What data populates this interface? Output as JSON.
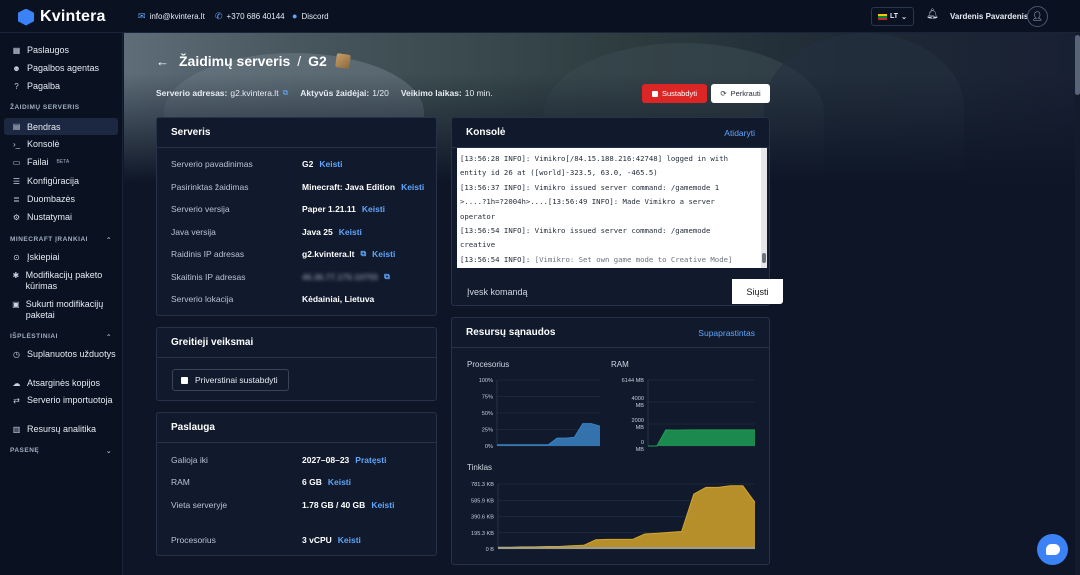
{
  "brand": {
    "name": "Kvintera"
  },
  "topbar": {
    "email": "info@kvintera.lt",
    "phone": "+370 686 40144",
    "discord": "Discord",
    "language": "LT",
    "user": "Vardenis Pavardenis"
  },
  "sidebar": {
    "items_top": [
      {
        "label": "Paslaugos",
        "icon": "grid-icon"
      },
      {
        "label": "Pagalbos agentas",
        "icon": "agent-icon"
      },
      {
        "label": "Pagalba",
        "icon": "help-icon"
      }
    ],
    "section_server": "ŽAIDIMŲ SERVERIS",
    "items_server": [
      {
        "label": "Bendras",
        "icon": "dashboard-icon",
        "active": true
      },
      {
        "label": "Konsolė",
        "icon": "terminal-icon"
      },
      {
        "label": "Failai",
        "icon": "folder-icon",
        "badge": "BETA"
      },
      {
        "label": "Konfigūracija",
        "icon": "sliders-icon"
      },
      {
        "label": "Duombazės",
        "icon": "database-icon"
      },
      {
        "label": "Nustatymai",
        "icon": "gear-icon"
      }
    ],
    "section_tools": "MINECRAFT ĮRANKIAI",
    "items_tools": [
      {
        "label": "Įskiepiai",
        "icon": "plugin-icon"
      },
      {
        "label": "Modifikacijų paketo kūrimas",
        "icon": "puzzle-icon"
      },
      {
        "label": "Sukurti modifikacijų paketai",
        "icon": "package-icon"
      }
    ],
    "section_advanced": "IŠPLĖSTINIAI",
    "items_advanced": [
      {
        "label": "Suplanuotos užduotys",
        "icon": "clock-icon"
      },
      {
        "label": "Atsarginės kopijos",
        "icon": "cloud-icon"
      },
      {
        "label": "Serverio importuotoja",
        "icon": "import-icon"
      },
      {
        "label": "Resursų analitika",
        "icon": "analytics-icon"
      }
    ],
    "section_pasene": "PASENĘ"
  },
  "page": {
    "title": "Žaidimų serveris",
    "separator": "/",
    "server_name": "G2",
    "address_label": "Serverio adresas:",
    "address_value": "g2.kvintera.lt",
    "players_label": "Aktyvūs žaidėjai:",
    "players_value": "1/20",
    "wait_label": "Veikimo laikas:",
    "wait_value": "10 min.",
    "stop_button": "Sustabdyti",
    "restart_button": "Perkrauti"
  },
  "server_card": {
    "title": "Serveris",
    "rows": [
      {
        "key": "Serverio pavadinimas",
        "value": "G2",
        "action": "Keisti"
      },
      {
        "key": "Pasirinktas žaidimas",
        "value": "Minecraft: Java Edition",
        "action": "Keisti"
      },
      {
        "key": "Serverio versija",
        "value": "Paper 1.21.11",
        "action": "Keisti"
      },
      {
        "key": "Java versija",
        "value": "Java 25",
        "action": "Keisti"
      },
      {
        "key": "Raidinis IP adresas",
        "value": "g2.kvintera.lt",
        "action": "Keisti"
      },
      {
        "key": "Skaitinis IP adresas",
        "value": "46.36.77.175:10755"
      },
      {
        "key": "Serverio lokacija",
        "value": "Kėdainiai, Lietuva"
      }
    ]
  },
  "quick_actions": {
    "title": "Greitieji veiksmai",
    "force_stop": "Priverstinai sustabdyti"
  },
  "service_card": {
    "title": "Paslauga",
    "rows": [
      {
        "key": "Galioja iki",
        "value": "2027–08–23",
        "action": "Pratęsti"
      },
      {
        "key": "RAM",
        "value": "6 GB",
        "action": "Keisti"
      },
      {
        "key": "Vieta serveryje",
        "value": "1.78 GB / 40 GB",
        "action": "Keisti"
      },
      {
        "key": "Procesorius",
        "value": "3 vCPU",
        "action": "Keisti"
      }
    ],
    "storage_fraction": 0.0445
  },
  "console": {
    "title": "Konsolė",
    "open_link": "Atidaryti",
    "lines": [
      "[13:56:28 INFO]: Vimikro[/84.15.188.216:42748] logged in with",
      "entity id 26 at ([world]-323.5, 63.0, -465.5)",
      "[13:56:37 INFO]: Vimikro issued server command: /gamemode 1",
      ">....?1h=?2004h>....[13:56:49 INFO]: Made Vimikro a server",
      "operator",
      "[13:56:54 INFO]: Vimikro issued server command: /gamemode",
      "creative"
    ],
    "last_line_prefix": "[13:56:54 INFO]: ",
    "last_line_rest": "[Vimikro: Set own game mode to Creative Mode]",
    "input_placeholder": "Įvesk komandą",
    "send_button": "Siųsti"
  },
  "resources": {
    "title": "Resursų sąnaudos",
    "simplified_link": "Supaprastintas",
    "colors": {
      "cpu": "#3b82c4",
      "ram": "#1f9d55",
      "network_in": "#d4a52a",
      "network_out": "#8fa3b8"
    }
  },
  "chart_data": [
    {
      "type": "area",
      "title": "Procesorius",
      "y_ticks": [
        "100%",
        "75%",
        "50%",
        "25%",
        "0%"
      ],
      "ylim": [
        0,
        100
      ],
      "x": [
        0,
        1,
        2,
        3,
        4,
        5,
        6,
        7,
        8,
        9,
        10,
        11,
        12
      ],
      "series": [
        {
          "values": [
            2,
            2,
            2,
            2,
            2,
            2,
            2,
            12,
            12,
            13,
            34,
            34,
            30
          ]
        }
      ]
    },
    {
      "type": "area",
      "title": "RAM",
      "y_ticks": [
        "6144 MB",
        "4000 MB",
        "2000 MB",
        "0 MB"
      ],
      "ylim": [
        0,
        6144
      ],
      "x": [
        0,
        1,
        2,
        3,
        4,
        5,
        6,
        7,
        8,
        9,
        10,
        11,
        12
      ],
      "series": [
        {
          "values": [
            0,
            0,
            1500,
            1480,
            1490,
            1500,
            1500,
            1500,
            1500,
            1500,
            1500,
            1500,
            1500
          ]
        }
      ]
    },
    {
      "type": "area",
      "title": "Tinklas",
      "y_ticks": [
        "781.3 KB",
        "585.9 KB",
        "390.6 KB",
        "195.3 KB",
        "0 B"
      ],
      "ylim": [
        0,
        781.3
      ],
      "x": [
        0,
        1,
        2,
        3,
        4,
        5,
        6,
        7,
        8,
        9,
        10,
        11,
        12,
        13,
        14,
        15,
        16,
        17,
        18,
        19,
        20,
        21
      ],
      "series": [
        {
          "values": [
            20,
            20,
            25,
            25,
            30,
            30,
            40,
            45,
            110,
            115,
            115,
            115,
            180,
            190,
            200,
            210,
            660,
            740,
            740,
            760,
            760,
            560
          ]
        },
        {
          "values": [
            15,
            15,
            15,
            15,
            15,
            15,
            15,
            15,
            15,
            15,
            15,
            15,
            15,
            15,
            15,
            15,
            15,
            15,
            15,
            15,
            15,
            15
          ]
        }
      ]
    }
  ]
}
